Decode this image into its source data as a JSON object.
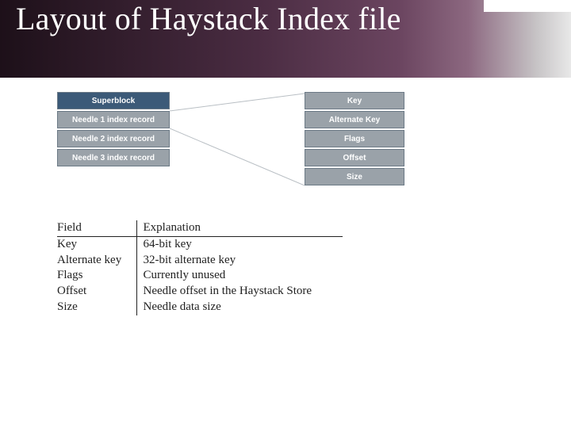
{
  "title": "Layout of Haystack Index file",
  "index_blocks": {
    "super": "Superblock",
    "rec1": "Needle 1 index record",
    "rec2": "Needle 2 index record",
    "rec3": "Needle 3 index record"
  },
  "needle_fields": {
    "f0": "Key",
    "f1": "Alternate Key",
    "f2": "Flags",
    "f3": "Offset",
    "f4": "Size"
  },
  "table": {
    "head_field": "Field",
    "head_exp": "Explanation",
    "rows": [
      {
        "field": "Key",
        "exp": "64-bit key"
      },
      {
        "field": "Alternate key",
        "exp": "32-bit alternate key"
      },
      {
        "field": "Flags",
        "exp": "Currently unused"
      },
      {
        "field": "Offset",
        "exp": "Needle offset in the Haystack Store"
      },
      {
        "field": "Size",
        "exp": "Needle data size"
      }
    ]
  }
}
